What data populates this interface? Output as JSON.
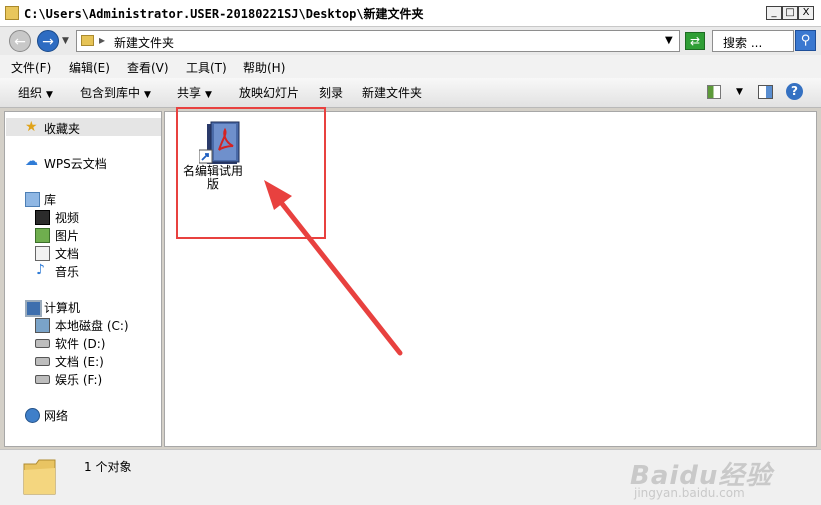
{
  "window": {
    "title": "C:\\Users\\Administrator.USER-20180221SJ\\Desktop\\新建文件夹",
    "controls": {
      "minimize": "_",
      "maximize": "□",
      "close": "X"
    }
  },
  "address": {
    "path": "新建文件夹",
    "search_placeholder": "搜索 ..."
  },
  "menu": [
    "文件(F)",
    "编辑(E)",
    "查看(V)",
    "工具(T)",
    "帮助(H)"
  ],
  "toolbar": {
    "organize": "组织",
    "include_library": "包含到库中",
    "share": "共享",
    "slideshow": "放映幻灯片",
    "burn": "刻录",
    "new_folder": "新建文件夹"
  },
  "nav": {
    "favorites": "收藏夹",
    "wps_cloud": "WPS云文档",
    "libraries": "库",
    "library_items": [
      "视频",
      "图片",
      "文档",
      "音乐"
    ],
    "computer": "计算机",
    "drives": [
      "本地磁盘 (C:)",
      "软件 (D:)",
      "文档 (E:)",
      "娱乐 (F:)"
    ],
    "network": "网络"
  },
  "content": {
    "files": [
      {
        "name": "名编辑试用版",
        "icon": "pdf-shortcut-icon"
      }
    ]
  },
  "status": {
    "count": "1 个对象"
  },
  "watermark": {
    "main": "Baidu经验",
    "sub": "jingyan.baidu.com"
  },
  "colors": {
    "highlight": "#e8413f",
    "arrow": "#e8413f",
    "accent_blue": "#2e6cc2"
  }
}
